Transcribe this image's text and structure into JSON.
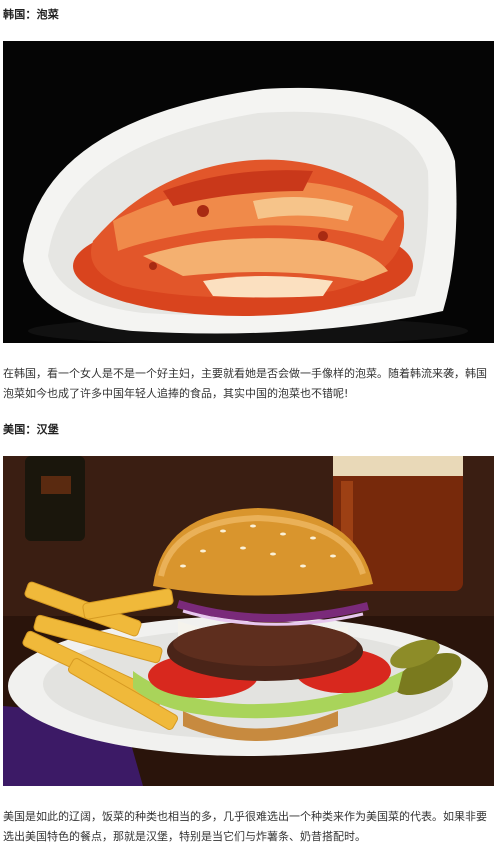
{
  "sections": [
    {
      "heading": "韩国：泡菜",
      "image_subject": "kimchi-bowl",
      "paragraph": "在韩国，看一个女人是不是一个好主妇，主要就看她是否会做一手像样的泡菜。随着韩流来袭，韩国泡菜如今也成了许多中国年轻人追捧的食品，其实中国的泡菜也不错呢!"
    },
    {
      "heading": "美国：汉堡",
      "image_subject": "burger-plate",
      "paragraph": "美国是如此的辽阔，饭菜的种类也相当的多，几乎很难选出一个种类来作为美国菜的代表。如果非要选出美国特色的餐点，那就是汉堡，特别是当它们与炸薯条、奶昔搭配时。"
    }
  ],
  "colors": {
    "kimchi_background": "#050505",
    "burger_background": "#3a1e12",
    "accent_red": "#d8502a"
  }
}
